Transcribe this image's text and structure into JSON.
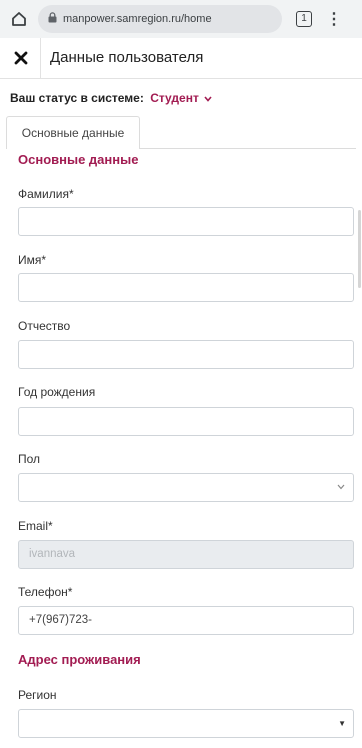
{
  "browser": {
    "url": "manpower.samregion.ru/home",
    "tab_count": "1",
    "menu_glyph": "⋮"
  },
  "modal": {
    "close_glyph": "✕",
    "title": "Данные пользователя"
  },
  "status": {
    "label": "Ваш статус в системе:",
    "value": "Студент"
  },
  "tab": {
    "label": "Основные данные"
  },
  "sections": {
    "basic": "Основные данные",
    "address": "Адрес проживания"
  },
  "fields": {
    "last_name": {
      "label": "Фамилия*",
      "value": ""
    },
    "first_name": {
      "label": "Имя*",
      "value": ""
    },
    "patronymic": {
      "label": "Отчество",
      "value": ""
    },
    "birth_year": {
      "label": "Год рождения",
      "value": ""
    },
    "gender": {
      "label": "Пол",
      "value": ""
    },
    "email": {
      "label": "Email*",
      "value": "ivannava"
    },
    "phone": {
      "label": "Телефон*",
      "value": "+7(967)723-"
    },
    "region": {
      "label": "Регион",
      "value": ""
    }
  },
  "colors": {
    "accent": "#a21c52",
    "browser_bar": "#f1f3f4"
  },
  "icons": {
    "home": "home-icon",
    "lock": "lock-icon",
    "tabs": "tabs-icon",
    "menu": "menu-icon",
    "close": "close-icon",
    "chevron": "chevron-down-icon"
  }
}
